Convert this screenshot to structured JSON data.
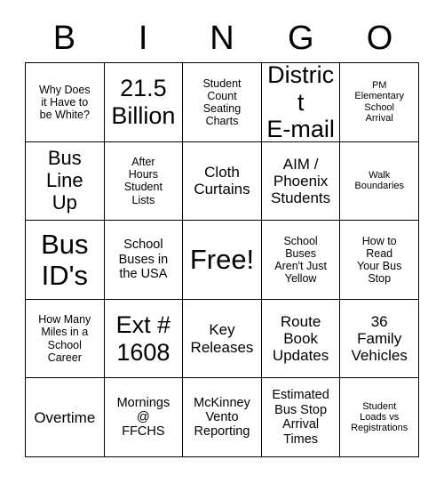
{
  "card": {
    "title": "Bingo Card",
    "header_letters": [
      "B",
      "I",
      "N",
      "G",
      "O"
    ],
    "free_space_label": "Free!",
    "colors": {
      "background": "#ffffff",
      "text": "#000000",
      "border": "#000000"
    },
    "grid_size": "5x5",
    "rows": [
      [
        {
          "text": "Why Does\nit Have to\nbe White?",
          "size": "xs"
        },
        {
          "text": "21.5\nBillion",
          "size": "xl"
        },
        {
          "text": "Student\nCount\nSeating\nCharts",
          "size": "xs"
        },
        {
          "text": "District\nE-mail",
          "size": "xl"
        },
        {
          "text": "PM\nElementary\nSchool\nArrival",
          "size": "xxs"
        }
      ],
      [
        {
          "text": "Bus\nLine\nUp",
          "size": "lg"
        },
        {
          "text": "After\nHours\nStudent\nLists",
          "size": "xs"
        },
        {
          "text": "Cloth\nCurtains",
          "size": "md"
        },
        {
          "text": "AIM /\nPhoenix\nStudents",
          "size": "md"
        },
        {
          "text": "Walk\nBoundaries",
          "size": "xxs"
        }
      ],
      [
        {
          "text": "Bus\nID's",
          "size": "xxl"
        },
        {
          "text": "School\nBuses in\nthe USA",
          "size": "sm"
        },
        {
          "text": "Free!",
          "size": "xxl"
        },
        {
          "text": "School\nBuses\nAren't Just\nYellow",
          "size": "xs"
        },
        {
          "text": "How to\nRead\nYour Bus\nStop",
          "size": "xs"
        }
      ],
      [
        {
          "text": "How Many\nMiles in a\nSchool\nCareer",
          "size": "xs"
        },
        {
          "text": "Ext #\n1608",
          "size": "xl"
        },
        {
          "text": "Key\nReleases",
          "size": "md"
        },
        {
          "text": "Route\nBook\nUpdates",
          "size": "md"
        },
        {
          "text": "36\nFamily\nVehicles",
          "size": "md"
        }
      ],
      [
        {
          "text": "Overtime",
          "size": "md"
        },
        {
          "text": "Mornings\n@\nFFCHS",
          "size": "sm"
        },
        {
          "text": "McKinney\nVento\nReporting",
          "size": "sm"
        },
        {
          "text": "Estimated\nBus Stop\nArrival\nTimes",
          "size": "sm"
        },
        {
          "text": "Student\nLoads vs\nRegistrations",
          "size": "xxs"
        }
      ]
    ]
  }
}
